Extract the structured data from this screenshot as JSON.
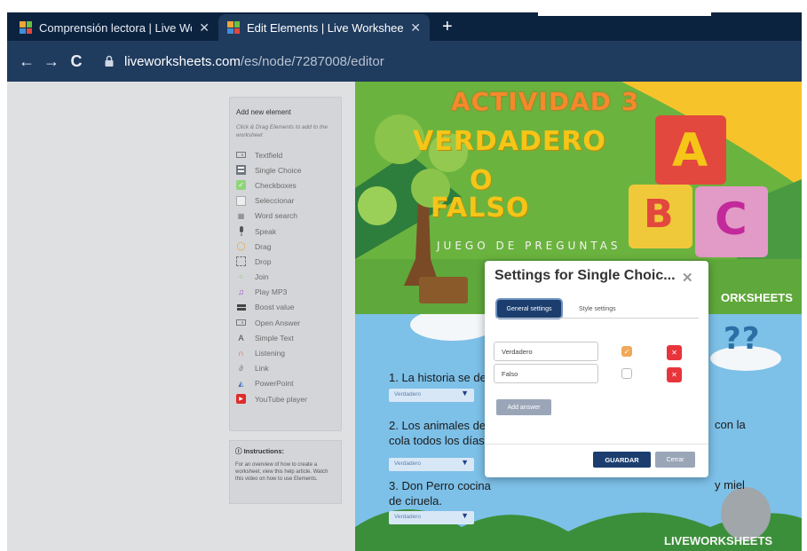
{
  "browser": {
    "tabs": [
      {
        "label": "Comprensión lectora | Live Work",
        "active": false
      },
      {
        "label": "Edit Elements | Live Worksheets",
        "active": true
      }
    ],
    "new_tab_icon": "plus-icon",
    "url_host": "liveworksheets.com",
    "url_path": "/es/node/7287008/editor"
  },
  "sidebar": {
    "title": "Add new element",
    "subtitle": "Click & Drag Elements to add to the worksheet",
    "items": [
      {
        "label": "Textfield",
        "icon": "textfield-icon"
      },
      {
        "label": "Single Choice",
        "icon": "single-choice-icon"
      },
      {
        "label": "Checkboxes",
        "icon": "checkbox-icon"
      },
      {
        "label": "Seleccionar",
        "icon": "select-icon"
      },
      {
        "label": "Word search",
        "icon": "word-search-icon"
      },
      {
        "label": "Speak",
        "icon": "microphone-icon"
      },
      {
        "label": "Drag",
        "icon": "drag-icon"
      },
      {
        "label": "Drop",
        "icon": "drop-icon"
      },
      {
        "label": "Join",
        "icon": "join-icon"
      },
      {
        "label": "Play MP3",
        "icon": "music-icon"
      },
      {
        "label": "Boost value",
        "icon": "boost-icon"
      },
      {
        "label": "Open Answer",
        "icon": "open-answer-icon"
      },
      {
        "label": "Simple Text",
        "icon": "text-icon"
      },
      {
        "label": "Listening",
        "icon": "headphones-icon"
      },
      {
        "label": "Link",
        "icon": "link-icon"
      },
      {
        "label": "PowerPoint",
        "icon": "powerpoint-icon"
      },
      {
        "label": "YouTube player",
        "icon": "youtube-icon"
      }
    ],
    "instructions_title": "Instructions:",
    "instructions_text": "For an overview of how to create a worksheet, view this help article. Watch this video on how to use Elements."
  },
  "worksheet": {
    "activity_title": "ACTIVIDAD 3",
    "line1": "VERDADERO",
    "line2": "O",
    "line3": "FALSO",
    "tagline": "JUEGO DE PREGUNTAS",
    "brand_banner": "ORKSHEETS",
    "brand_footer": "LIVEWORKSHEETS",
    "letters": [
      "A",
      "B",
      "C"
    ],
    "questions": [
      {
        "text_left": "1. La historia se des",
        "text_right": "",
        "select": "Verdadero"
      },
      {
        "text_left": "2. Los animales de",
        "text_left2": "cola todos los días",
        "text_right": "con la",
        "select": "Verdadero"
      },
      {
        "text_left": "3. Don Perro cocina",
        "text_left2": "de ciruela.",
        "text_right": "y miel",
        "select": "Verdadero"
      }
    ]
  },
  "modal": {
    "title": "Settings for Single Choic...",
    "close_icon": "close-icon",
    "tabs": [
      {
        "label": "General settings",
        "active": true
      },
      {
        "label": "Style settings",
        "active": false
      }
    ],
    "answers": [
      {
        "value": "Verdadero",
        "correct": true
      },
      {
        "value": "Falso",
        "correct": false
      }
    ],
    "add_answer_label": "Add answer",
    "save_label": "GUARDAR",
    "cancel_label": "Cerrar",
    "colors": {
      "primary": "#1b3e6f",
      "danger": "#e8343b",
      "muted": "#9aa6b8",
      "check": "#f0a95a"
    }
  }
}
